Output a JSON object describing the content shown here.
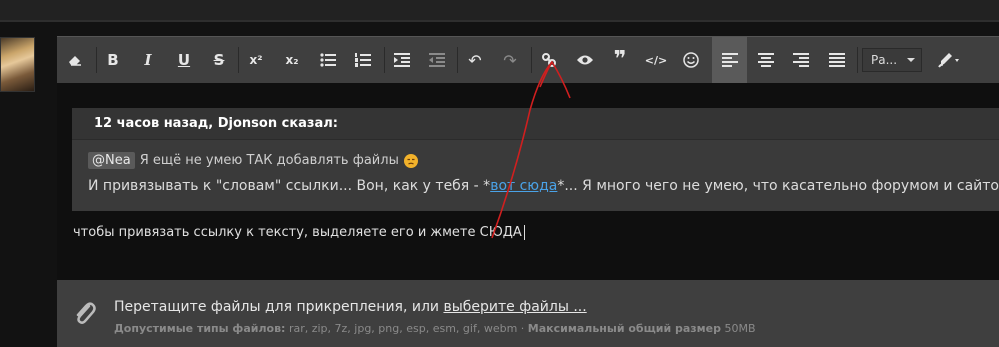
{
  "quote": {
    "header": "12 часов назад, Djonson сказал:",
    "mention": "@Nea",
    "line1": "Я ещё не умею ТАК добавлять файлы",
    "line2_before": "И привязывать к \"словам\" ссылки... Вон, как у тебя - *",
    "line2_link": "вот сюда",
    "line2_after": "*... Я много чего не умею, что касательно форумом и сайтов"
  },
  "body_text": "чтобы привязать ссылку к тексту, выделяете его и жмете СЮДА",
  "toolbar": {
    "font_select": "Ра...",
    "buttons": [
      "eraser",
      "bold",
      "italic",
      "underline",
      "strikethrough",
      "superscript",
      "subscript",
      "bulleted-list",
      "numbered-list",
      "indent",
      "outdent",
      "undo",
      "redo",
      "link",
      "preview",
      "quote",
      "code",
      "emoji",
      "align-left",
      "align-center",
      "align-right",
      "align-justify",
      "format-painter"
    ]
  },
  "attach": {
    "main_text": "Перетащите файлы для прикрепления, или ",
    "main_link": "выберите файлы ...",
    "types_label": "Допустимые типы файлов:",
    "types_value": "rar, zip, 7z, jpg, png, esp, esm, gif, webm",
    "size_label": "Максимальный общий размер",
    "size_value": "50MB",
    "sep": " · "
  },
  "colors": {
    "background": "#121212",
    "editor": "#3f3f3f",
    "link": "#4aa3e8",
    "annotation": "#d01f1f"
  }
}
